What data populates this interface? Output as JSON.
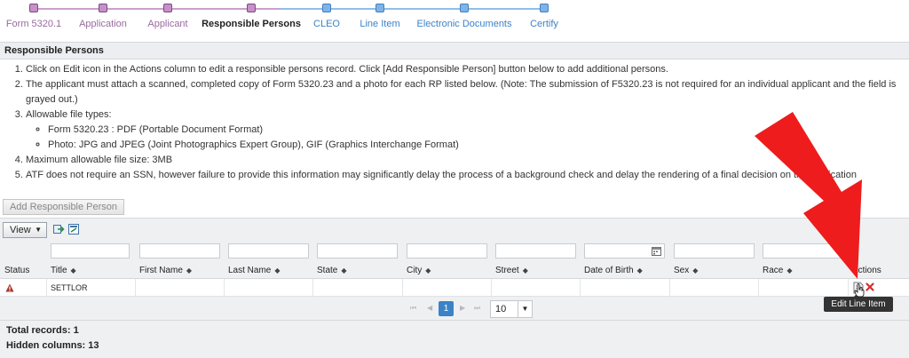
{
  "stepper": {
    "steps": [
      {
        "label": "Form 5320.1",
        "state": "done"
      },
      {
        "label": "Application",
        "state": "done"
      },
      {
        "label": "Applicant",
        "state": "done"
      },
      {
        "label": "Responsible Persons",
        "state": "current"
      },
      {
        "label": "CLEO",
        "state": "future"
      },
      {
        "label": "Line Item",
        "state": "future"
      },
      {
        "label": "Electronic Documents",
        "state": "future"
      },
      {
        "label": "Certify",
        "state": "future"
      }
    ],
    "colors": {
      "done": "#c790c8",
      "future": "#7fb3e8"
    }
  },
  "panel": {
    "title": "Responsible Persons",
    "instructions": {
      "item1": "Click on Edit icon in the Actions column to edit a responsible persons record. Click [Add Responsible Person] button below to add additional persons.",
      "item2": "The applicant must attach a scanned, completed copy of Form 5320.23 and a photo for each RP listed below. (Note: The submission of F5320.23 is not required for an individual applicant and the field is",
      "item2_cont": "grayed out.)",
      "item3": "Allowable file types:",
      "item3_sub1": "Form 5320.23 : PDF (Portable Document Format)",
      "item3_sub2": "Photo: JPG and JPEG (Joint Photographics Expert Group), GIF (Graphics Interchange Format)",
      "item4": "Maximum allowable file size: 3MB",
      "item5": "ATF does not require an SSN, however failure to provide this information may significantly delay the process of a background check and delay the rendering of a final decision on the application"
    },
    "add_button": "Add Responsible Person"
  },
  "grid": {
    "view_label": "View",
    "columns": {
      "status": "Status",
      "title": "Title",
      "first_name": "First Name",
      "last_name": "Last Name",
      "state": "State",
      "city": "City",
      "street": "Street",
      "dob": "Date of Birth",
      "sex": "Sex",
      "race": "Race",
      "actions": "Actions"
    },
    "rows": [
      {
        "title": "SETTLOR"
      }
    ],
    "pager": {
      "current_page": "1",
      "page_size": "10"
    },
    "tooltip": "Edit Line Item",
    "total_records": "Total records: 1",
    "hidden_columns": "Hidden columns: 13"
  },
  "colors": {
    "accent": "#3b83c7",
    "arrow": "#ee1c1c",
    "warning_icon": "#a8342a",
    "delete_icon": "#d62f2f"
  }
}
